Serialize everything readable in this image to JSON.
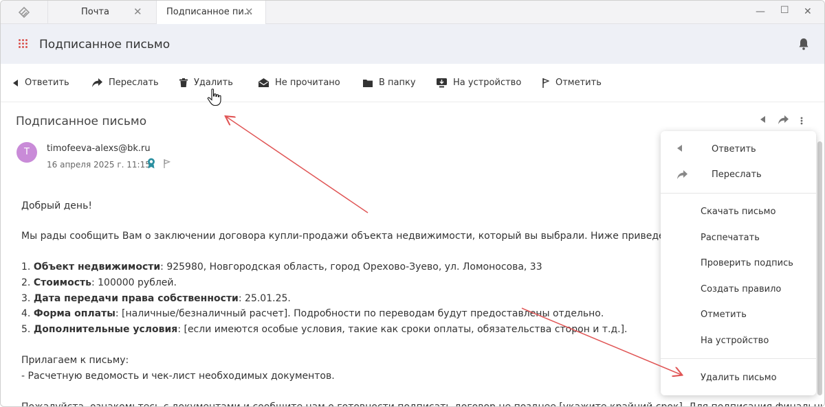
{
  "tabs": [
    {
      "label": "Почта"
    },
    {
      "label": "Подписанное пи..."
    }
  ],
  "header": {
    "title": "Подписанное письмо"
  },
  "toolbar": {
    "reply": "Ответить",
    "forward": "Переслать",
    "delete": "Удалить",
    "unread": "Не прочитано",
    "folder": "В папку",
    "device": "На устройство",
    "mark": "Отметить"
  },
  "message": {
    "subject": "Подписанное письмо",
    "avatar_letter": "T",
    "sender": "timofeeva-alexs@bk.ru",
    "date": "16 апреля 2025 г. 11:15",
    "greeting": "Добрый день!",
    "intro": "Мы рады сообщить Вам о заключении договора купли-продажи объекта недвижимости, который вы выбрали. Ниже приведены ос",
    "items": [
      {
        "num": "1. ",
        "key": "Объект недвижимости",
        "value": ": 925980, Новгородская область, город Орехово-Зуево, ул. Ломоносова, 33"
      },
      {
        "num": "2. ",
        "key": "Стоимость",
        "value": ": 100000 рублей."
      },
      {
        "num": "3. ",
        "key": "Дата передачи права собственности",
        "value": ": 25.01.25."
      },
      {
        "num": "4. ",
        "key": "Форма оплаты",
        "value": ": [наличные/безналичный расчет]. Подробности по переводам будут предоставлены отдельно."
      },
      {
        "num": "5. ",
        "key": "Дополнительные условия",
        "value": ": [если имеются особые условия, такие как сроки оплаты, обязательства сторон и т.д.]."
      }
    ],
    "attach_title": "Прилагаем к письму:",
    "attach_item": "- Расчетную ведомость и чек-лист необходимых документов.",
    "closing": "Пожалуйста, ознакомьтесь с документами и сообщите нам о готовности подписать договор не позднее [укажите крайний срок]. Для подписания финальных"
  },
  "dropdown": {
    "reply": "Ответить",
    "forward": "Переслать",
    "download": "Скачать письмо",
    "print": "Распечатать",
    "verify": "Проверить подпись",
    "rule": "Создать правило",
    "mark": "Отметить",
    "device": "На устройство",
    "delete": "Удалить письмо"
  },
  "colors": {
    "accent_red": "#d9534f",
    "avatar": "#c98bd8",
    "annotation_arrow": "#e05555"
  }
}
